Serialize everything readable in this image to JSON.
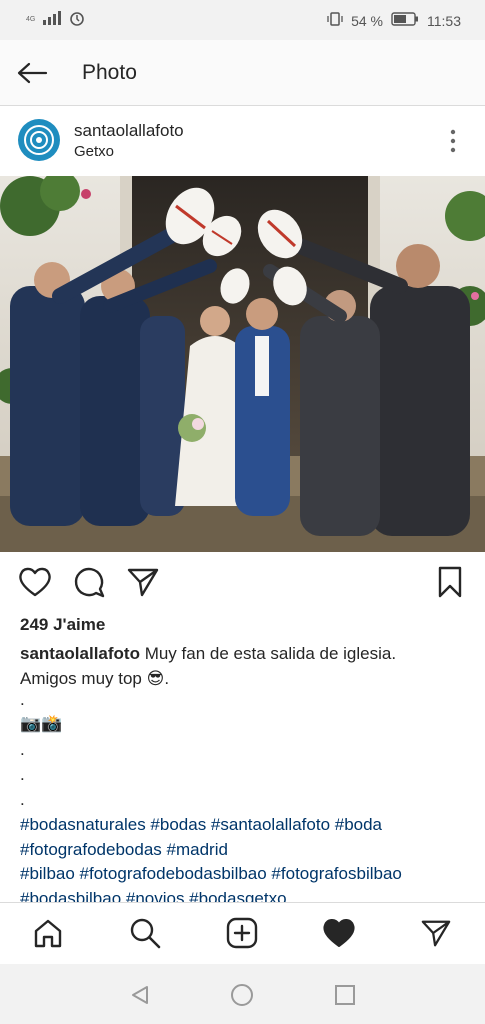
{
  "status_bar": {
    "network": "4G",
    "battery_percent": "54 %",
    "time": "11:53"
  },
  "header": {
    "title": "Photo"
  },
  "post": {
    "username": "santaolallafoto",
    "location": "Getxo",
    "likes": "249 J'aime",
    "caption_text": " Muy fan de esta salida de iglesia.",
    "caption_line2": "Amigos muy top 😎.",
    "dot": ".",
    "cameras": "📷📸",
    "hashtags_line1": "#bodasnaturales #bodas #santaolallafoto #boda",
    "hashtags_line2": "#fotografodebodas #madrid",
    "hashtags_line3": "#bilbao #fotografodebodasbilbao #fotografosbilbao",
    "hashtags_line4": "#bodasbilbao #novios #bodasgetxo"
  },
  "icons": {
    "back": "arrow-left-icon",
    "more": "more-vertical-icon",
    "like": "heart-outline-icon",
    "comment": "comment-icon",
    "share": "send-icon",
    "save": "bookmark-icon",
    "home": "home-icon",
    "search": "search-icon",
    "add": "add-post-icon",
    "activity": "heart-filled-icon",
    "direct": "send-icon"
  },
  "colors": {
    "hashtag": "#003569",
    "text": "#262626",
    "avatar": "#1f8dbf"
  }
}
